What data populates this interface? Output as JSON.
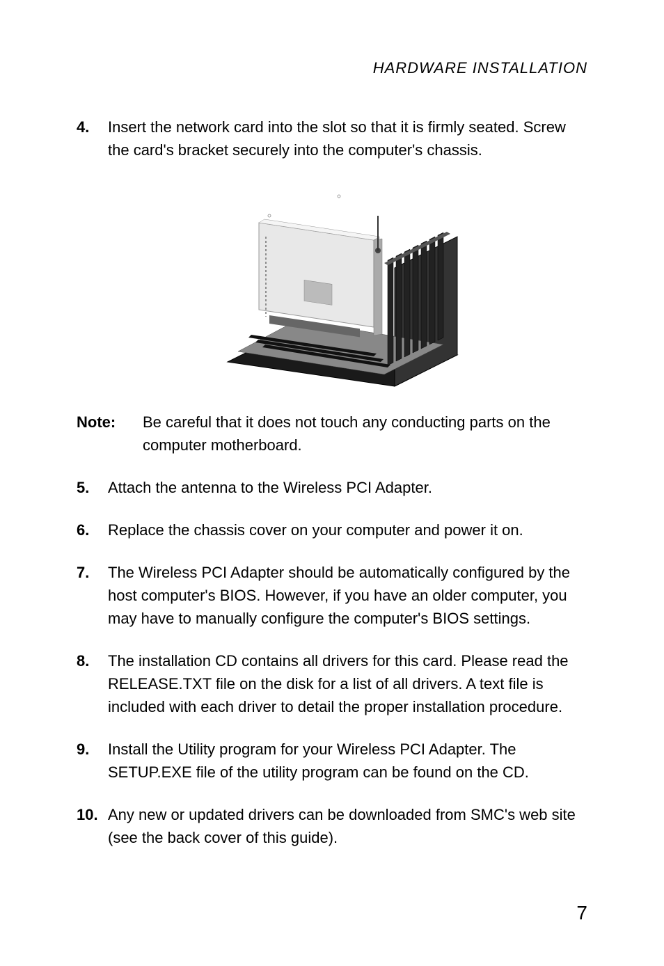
{
  "header": "HARDWARE INSTALLATION",
  "items": {
    "n4": "4.",
    "t4": "Insert the network card into the slot so that it is firmly seated. Screw the card's bracket securely into the computer's chassis.",
    "noteLabel": "Note:",
    "noteText": "Be careful that it does not touch any conducting parts on the computer motherboard.",
    "n5": "5.",
    "t5": "Attach the antenna to the Wireless PCI Adapter.",
    "n6": "6.",
    "t6": "Replace the chassis cover on your computer and power it on.",
    "n7": "7.",
    "t7": "The Wireless PCI Adapter should be automatically configured by the host computer's BIOS. However, if you have an older computer, you may have to manually configure the computer's BIOS settings.",
    "n8": "8.",
    "t8": "The installation CD contains all drivers for this card. Please read the RELEASE.TXT file on the disk for a list of all drivers. A text file is included with each driver to detail the proper installation procedure.",
    "n9": "9.",
    "t9": "Install the Utility program for your Wireless PCI Adapter. The SETUP.EXE file of the utility program can be found on the CD.",
    "n10": "10.",
    "t10": "Any new or updated drivers can be downloaded from SMC's web site (see the back cover of this guide)."
  },
  "pageNumber": "7"
}
